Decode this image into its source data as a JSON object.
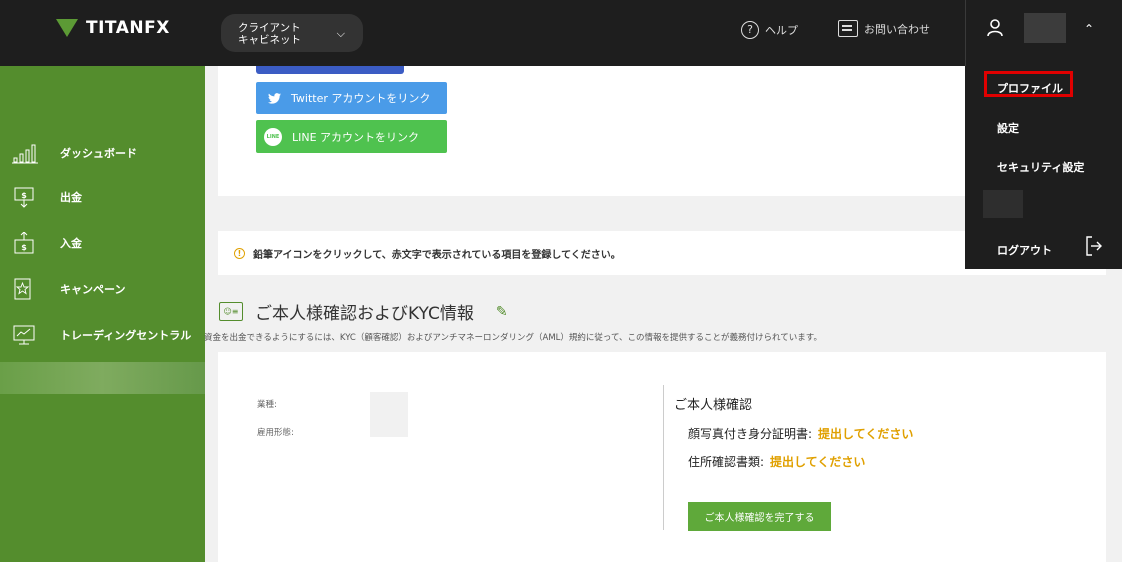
{
  "header": {
    "logo_text": "TITANFX",
    "portal_label_line1": "クライアント",
    "portal_label_line2": "キャビネット",
    "help_label": "ヘルプ",
    "contact_label": "お問い合わせ"
  },
  "sidebar": {
    "items": [
      {
        "label": "ダッシュボード",
        "icon": "chart-icon"
      },
      {
        "label": "出金",
        "icon": "withdraw-icon"
      },
      {
        "label": "入金",
        "icon": "deposit-icon"
      },
      {
        "label": "キャンペーン",
        "icon": "campaign-icon"
      },
      {
        "label": "トレーディングセントラル",
        "icon": "trading-icon"
      }
    ]
  },
  "social": {
    "twitter_label": "Twitter アカウントをリンク",
    "line_label": "LINE アカウントをリンク",
    "line_icon_text": "LINE"
  },
  "notice": {
    "text": "鉛筆アイコンをクリックして、赤文字で表示されている項目を登録してください。"
  },
  "kyc": {
    "section_title": "ご本人様確認およびKYC情報",
    "description": "資金を出金できるようにするには、KYC（顧客確認）およびアンチマネーロンダリング（AML）規約に従って、この情報を提供することが義務付けられています。",
    "fields": [
      {
        "label": "業種:"
      },
      {
        "label": "雇用形態:"
      }
    ],
    "verification_title": "ご本人様確認",
    "rows": [
      {
        "label": "顔写真付き身分証明書:",
        "status": "提出してください"
      },
      {
        "label": "住所確認書類:",
        "status": "提出してください"
      }
    ],
    "complete_button": "ご本人様確認を完了する"
  },
  "user_menu": {
    "items": [
      {
        "label": "プロファイル"
      },
      {
        "label": "設定"
      },
      {
        "label": "セキュリティ設定"
      },
      {
        "label": "ログアウト"
      }
    ]
  },
  "colors": {
    "brand_green": "#548d2d",
    "topbar": "#1e1e1e",
    "status_orange": "#e0a000",
    "highlight_red": "#e00000",
    "twitter_blue": "#4a9be8",
    "line_green": "#4fc24f"
  }
}
